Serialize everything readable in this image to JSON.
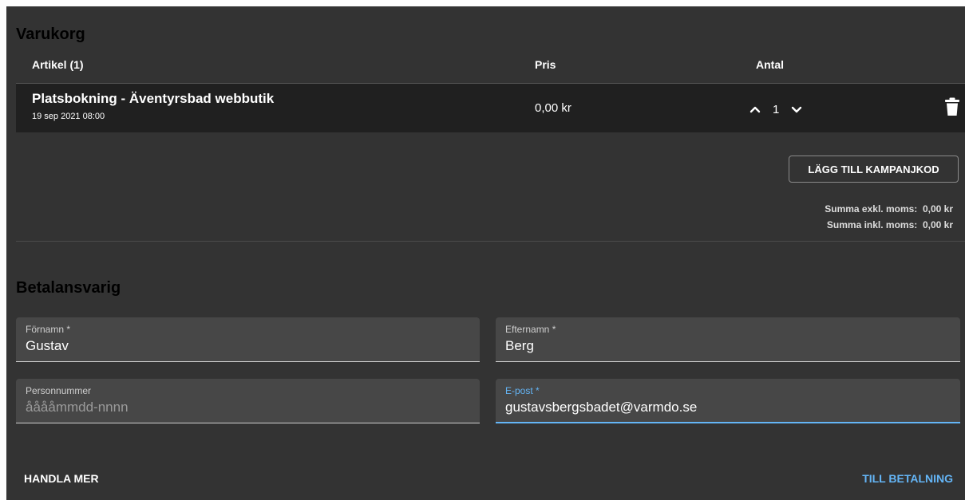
{
  "cart": {
    "title": "Varukorg",
    "columns": {
      "article": "Artikel (1)",
      "price": "Pris",
      "quantity": "Antal"
    },
    "items": [
      {
        "name": "Platsbokning - Äventyrsbad webbutik",
        "date": "19 sep 2021 08:00",
        "price": "0,00 kr",
        "quantity": "1",
        "icons": {
          "increase": "chevron-up-icon",
          "decrease": "chevron-down-icon",
          "remove": "trash-icon"
        }
      }
    ],
    "promo_button_label": "LÄGG TILL KAMPANJKOD",
    "totals": {
      "excl_vat_label": "Summa exkl. moms:",
      "excl_vat_value": "0,00 kr",
      "incl_vat_label": "Summa inkl. moms:",
      "incl_vat_value": "0,00 kr"
    }
  },
  "payer": {
    "title": "Betalansvarig",
    "fields": {
      "first_name": {
        "label": "Förnamn *",
        "value": "Gustav",
        "placeholder": ""
      },
      "last_name": {
        "label": "Efternamn *",
        "value": "Berg",
        "placeholder": ""
      },
      "personal_number": {
        "label": "Personnummer",
        "value": "",
        "placeholder": "ååååmmdd-nnnn"
      },
      "email": {
        "label": "E-post *",
        "value": "gustavsbergsbadet@varmdo.se",
        "placeholder": ""
      }
    }
  },
  "actions": {
    "shop_more": "HANDLA MER",
    "to_payment": "TILL BETALNING"
  },
  "colors": {
    "panel": "#333333",
    "row": "#202020",
    "field": "#474747",
    "accent": "#64b5f6",
    "title": "#000000"
  }
}
